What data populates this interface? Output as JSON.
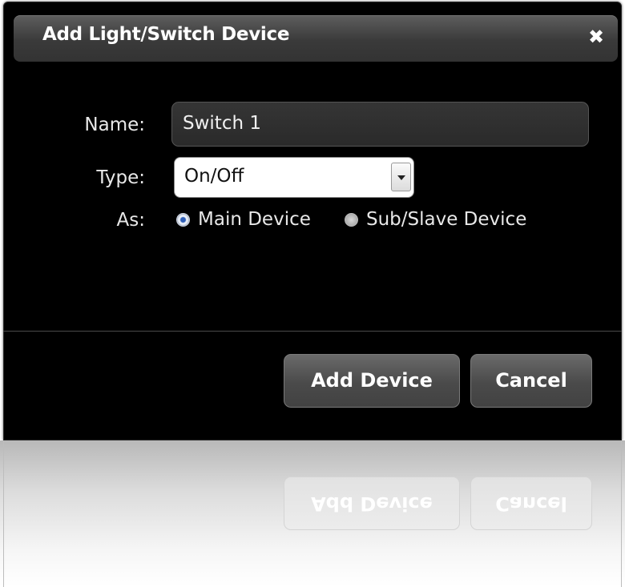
{
  "dialog": {
    "title": "Add Light/Switch Device",
    "close_glyph": "✖"
  },
  "form": {
    "name_label": "Name:",
    "name_value": "Switch 1",
    "type_label": "Type:",
    "type_value": "On/Off",
    "as_label": "As:",
    "as_options": [
      {
        "label": "Main Device",
        "selected": true
      },
      {
        "label": "Sub/Slave Device",
        "selected": false
      }
    ]
  },
  "buttons": {
    "add_label": "Add Device",
    "cancel_label": "Cancel"
  },
  "icons": {
    "close": "close-icon",
    "dropdown": "chevron-down-icon"
  }
}
